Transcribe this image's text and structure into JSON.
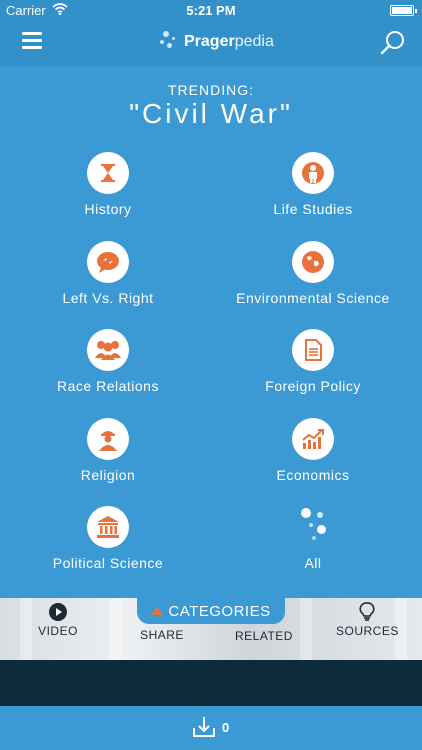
{
  "status_bar": {
    "carrier": "Carrier",
    "time": "5:21 PM"
  },
  "nav": {
    "logo_bold": "Prager",
    "logo_light": "pedia"
  },
  "trending": {
    "label": "TRENDING:",
    "title": "\"Civil War\""
  },
  "categories": [
    {
      "label": "History",
      "icon": "hourglass-icon"
    },
    {
      "label": "Life Studies",
      "icon": "person-icon"
    },
    {
      "label": "Left Vs. Right",
      "icon": "speech-bubbles-icon"
    },
    {
      "label": "Environmental Science",
      "icon": "globe-icon"
    },
    {
      "label": "Race Relations",
      "icon": "people-group-icon"
    },
    {
      "label": "Foreign Policy",
      "icon": "document-icon"
    },
    {
      "label": "Religion",
      "icon": "cleric-icon"
    },
    {
      "label": "Economics",
      "icon": "chart-growth-icon"
    },
    {
      "label": "Political Science",
      "icon": "government-building-icon"
    },
    {
      "label": "All",
      "icon": "dots-icon"
    }
  ],
  "tabs": {
    "categories": "CATEGORIES",
    "video": "VIDEO",
    "share": "SHARE",
    "related": "RELATED",
    "sources": "SOURCES"
  },
  "footer": {
    "download_count": "0"
  },
  "colors": {
    "primary": "#3b9ad3",
    "nav": "#3391c9",
    "accent": "#e8723a",
    "dark_band": "#0e2a3d"
  }
}
